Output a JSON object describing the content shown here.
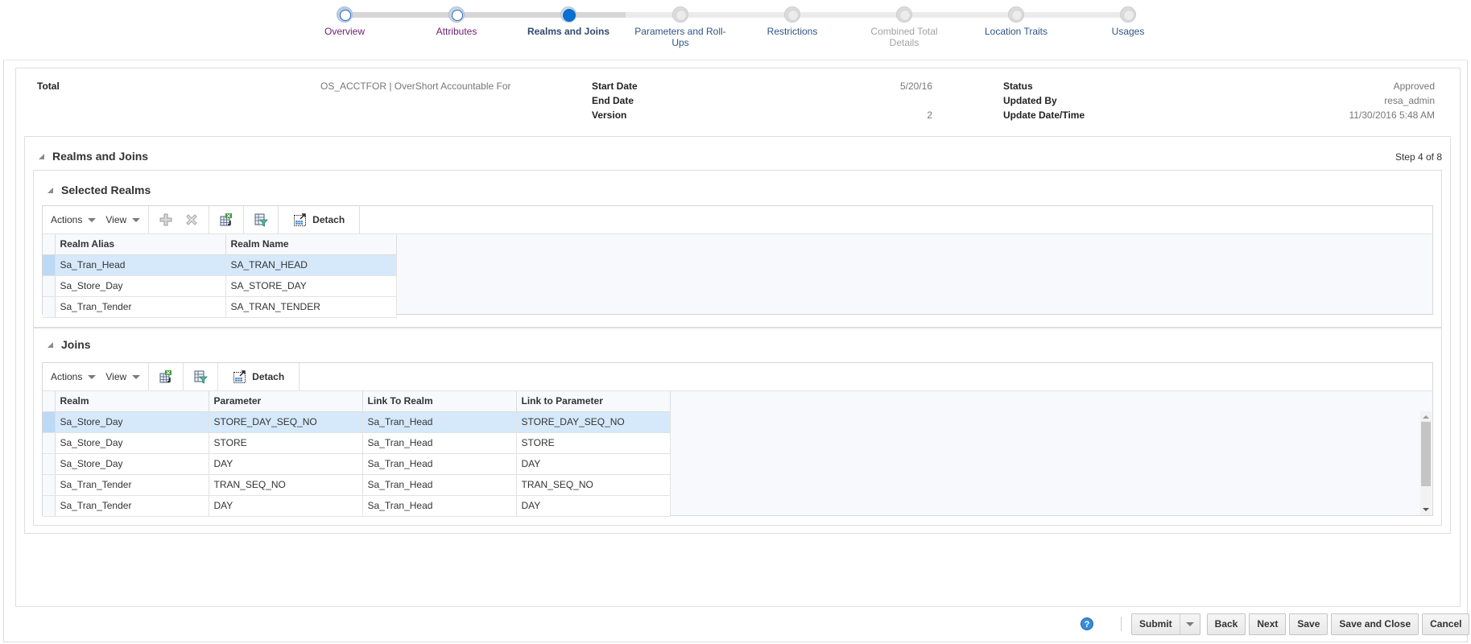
{
  "train": {
    "stops": [
      {
        "label": "Overview",
        "state": "visited"
      },
      {
        "label": "Attributes",
        "state": "visited"
      },
      {
        "label": "Realms and Joins",
        "state": "current"
      },
      {
        "label": "Parameters and Roll-Ups",
        "state": "normal"
      },
      {
        "label": "Restrictions",
        "state": "normal"
      },
      {
        "label": "Combined Total Details",
        "state": "disabled"
      },
      {
        "label": "Location Traits",
        "state": "normal"
      },
      {
        "label": "Usages",
        "state": "normal"
      }
    ]
  },
  "header": {
    "total_label": "Total",
    "total_value": "OS_ACCTFOR | OverShort Accountable For",
    "start_date_label": "Start Date",
    "start_date_value": "5/20/16",
    "end_date_label": "End Date",
    "end_date_value": "",
    "version_label": "Version",
    "version_value": "2",
    "status_label": "Status",
    "status_value": "Approved",
    "updated_by_label": "Updated By",
    "updated_by_value": "resa_admin",
    "update_datetime_label": "Update Date/Time",
    "update_datetime_value": "11/30/2016 5:48 AM"
  },
  "main_panel": {
    "title": "Realms and Joins",
    "step_text": "Step 4 of 8"
  },
  "selected_realms": {
    "title": "Selected Realms",
    "toolbar": {
      "actions_label": "Actions",
      "view_label": "View",
      "detach_label": "Detach",
      "icons": [
        "add-icon",
        "delete-icon",
        "export-excel-icon",
        "query-by-example-icon",
        "detach-icon"
      ]
    },
    "columns": [
      "Realm Alias",
      "Realm Name"
    ],
    "rows": [
      {
        "alias": "Sa_Tran_Head",
        "name": "SA_TRAN_HEAD",
        "selected": true
      },
      {
        "alias": "Sa_Store_Day",
        "name": "SA_STORE_DAY",
        "selected": false
      },
      {
        "alias": "Sa_Tran_Tender",
        "name": "SA_TRAN_TENDER",
        "selected": false
      }
    ]
  },
  "joins": {
    "title": "Joins",
    "toolbar": {
      "actions_label": "Actions",
      "view_label": "View",
      "detach_label": "Detach",
      "icons": [
        "export-excel-icon",
        "query-by-example-icon",
        "detach-icon"
      ]
    },
    "columns": [
      "Realm",
      "Parameter",
      "Link To Realm",
      "Link to Parameter"
    ],
    "rows": [
      {
        "realm": "Sa_Store_Day",
        "parameter": "STORE_DAY_SEQ_NO",
        "link_realm": "Sa_Tran_Head",
        "link_parameter": "STORE_DAY_SEQ_NO",
        "selected": true
      },
      {
        "realm": "Sa_Store_Day",
        "parameter": "STORE",
        "link_realm": "Sa_Tran_Head",
        "link_parameter": "STORE",
        "selected": false
      },
      {
        "realm": "Sa_Store_Day",
        "parameter": "DAY",
        "link_realm": "Sa_Tran_Head",
        "link_parameter": "DAY",
        "selected": false
      },
      {
        "realm": "Sa_Tran_Tender",
        "parameter": "TRAN_SEQ_NO",
        "link_realm": "Sa_Tran_Head",
        "link_parameter": "TRAN_SEQ_NO",
        "selected": false
      },
      {
        "realm": "Sa_Tran_Tender",
        "parameter": "DAY",
        "link_realm": "Sa_Tran_Head",
        "link_parameter": "DAY",
        "selected": false
      }
    ]
  },
  "footer": {
    "help_glyph": "?",
    "submit_label": "Submit",
    "back_label": "Back",
    "next_label": "Next",
    "save_label": "Save",
    "save_close_label": "Save and Close",
    "cancel_label": "Cancel"
  },
  "colors": {
    "accent": "#0a6fd0",
    "selected_row": "#d6e9fb",
    "visited_link": "#6b1e6e"
  }
}
